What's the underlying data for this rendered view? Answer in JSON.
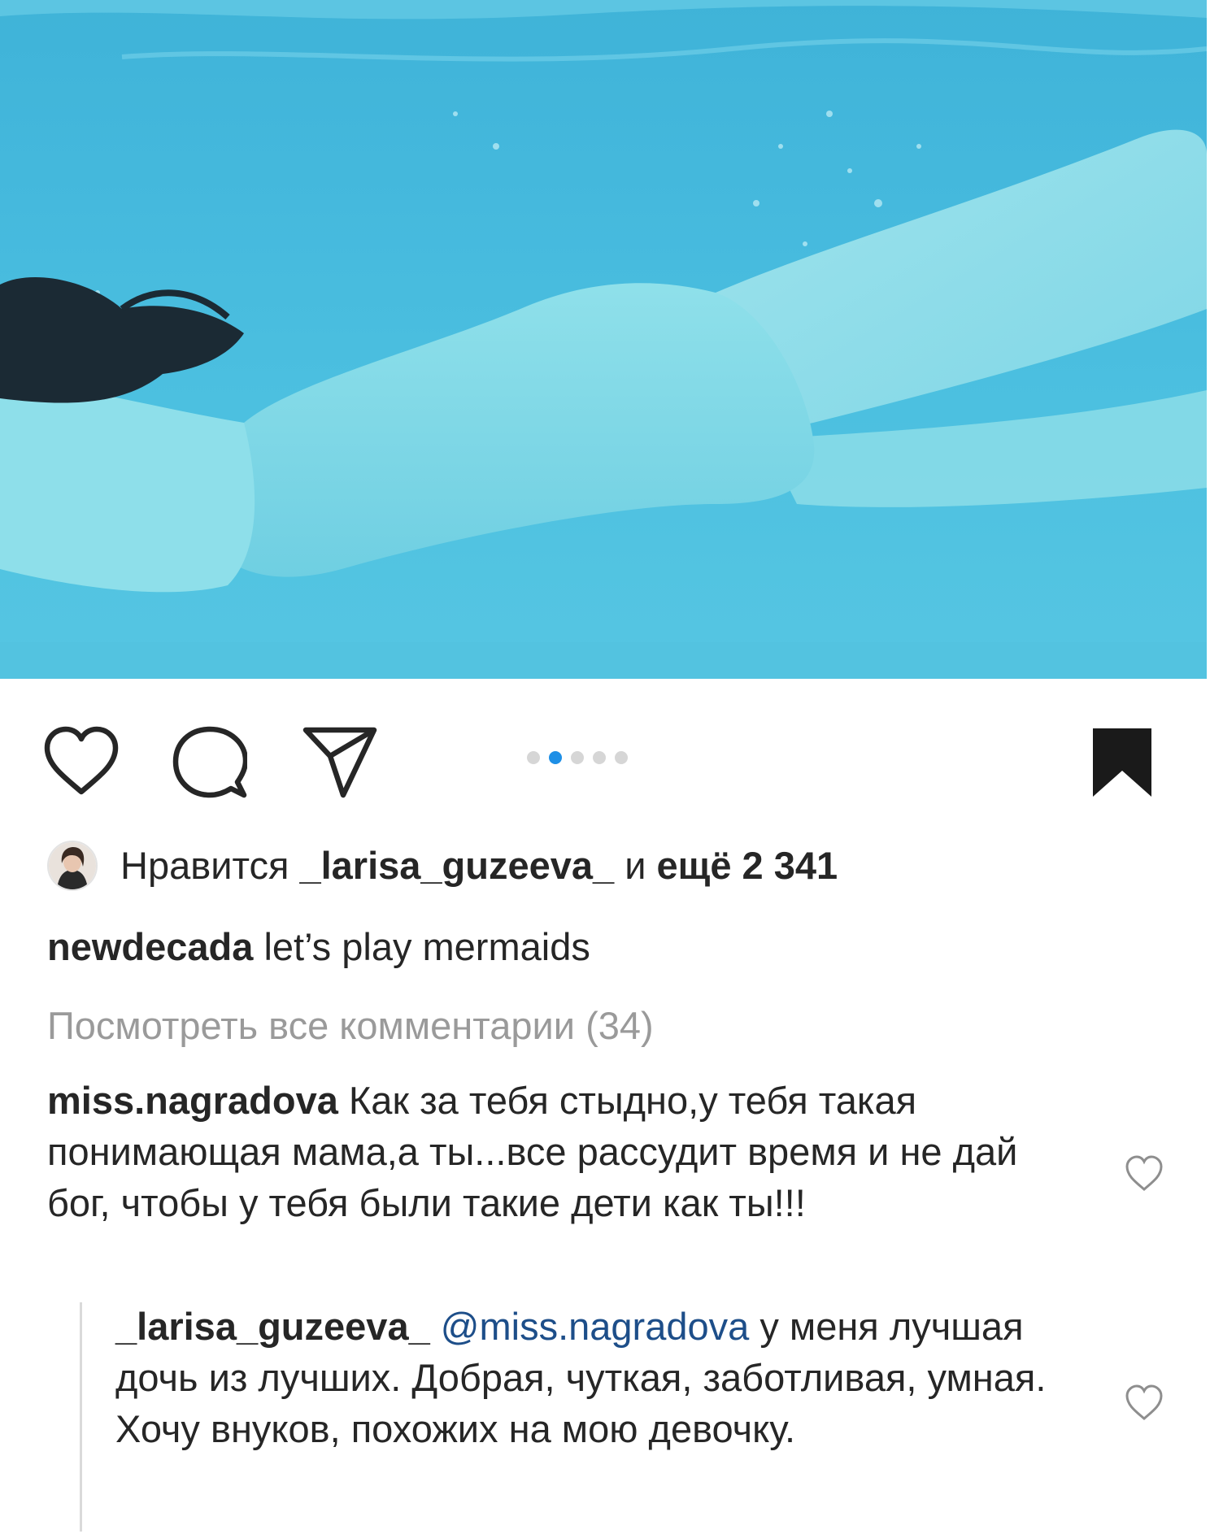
{
  "post": {
    "image": {
      "content": "underwater-swimmer-photo"
    },
    "carousel": {
      "count": 5,
      "active_index": 1
    }
  },
  "actions": {
    "like_icon": "heart-outline-icon",
    "comment_icon": "comment-bubble-icon",
    "share_icon": "paper-plane-icon",
    "save_icon": "bookmark-filled-icon"
  },
  "likes": {
    "prefix": "Нравится ",
    "user": "_larisa_guzeeva_",
    "middle": " и ",
    "count_text": "ещё 2 341"
  },
  "caption": {
    "user": "newdecada",
    "text": " let’s play mermaids"
  },
  "view_all_comments": "Посмотреть все комментарии (34)",
  "comment": {
    "user": "miss.nagradova",
    "text": " Как за тебя стыдно,у тебя такая понимающая мама,а ты...все рассудит время и не дай бог, чтобы у тебя были такие дети как ты!!!"
  },
  "reply": {
    "user": "_larisa_guzeeva_",
    "mention": "@miss.nagradova",
    "text": " у меня лучшая дочь из лучших. Добрая, чуткая, заботливая, умная. Хочу внуков, похожих на мою девочку."
  },
  "colors": {
    "water": "#4cc0e0",
    "active_dot": "#1e8fe6",
    "inactive_dot": "#d6d6d6",
    "mention": "#1d4e89",
    "muted_text": "#9a9a9a"
  }
}
